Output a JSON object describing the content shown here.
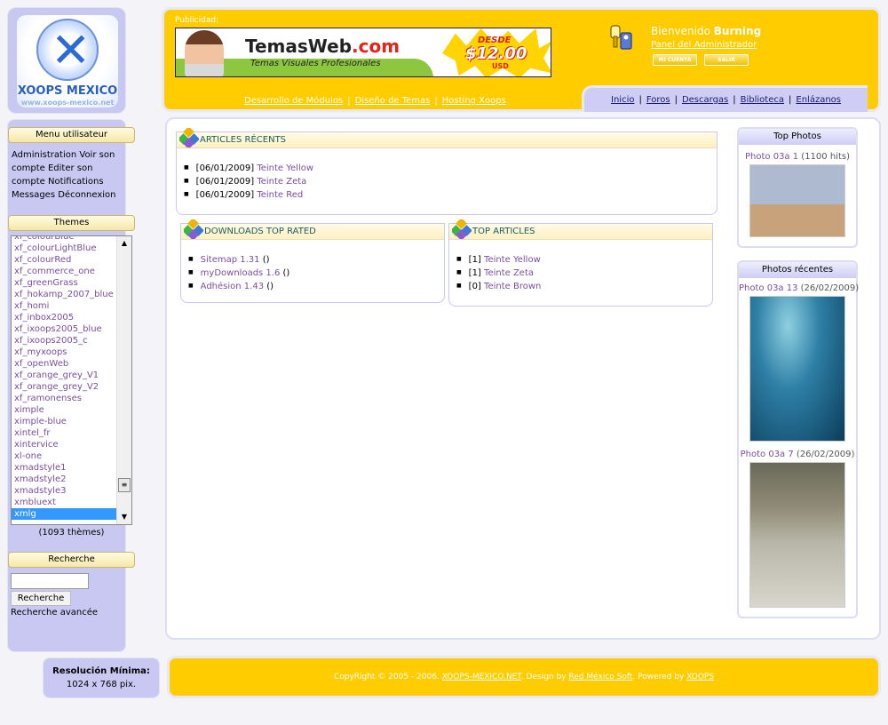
{
  "logo": {
    "title": "XOOPS MEXICO",
    "subtitle": "www.xoops-mexico.net"
  },
  "user_menu": {
    "title": "Menu utilisateur",
    "items": [
      "Administration",
      "Voir son compte",
      "Editer son compte",
      "Notifications",
      "Messages",
      "Déconnexion"
    ]
  },
  "themes": {
    "title": "Themes",
    "items": [
      "xf_colourBlue",
      "xf_colourLightBlue",
      "xf_colourRed",
      "xf_commerce_one",
      "xf_greenGrass",
      "xf_hokamp_2007_blue",
      "xf_homi",
      "xf_inbox2005",
      "xf_ixoops2005_blue",
      "xf_ixoops2005_c",
      "xf_myxoops",
      "xf_openWeb",
      "xf_orange_grey_V1",
      "xf_orange_grey_V2",
      "xf_ramonenses",
      "ximple",
      "ximple-blue",
      "xintel_fr",
      "xintervice",
      "xl-one",
      "xmadstyle1",
      "xmadstyle2",
      "xmadstyle3",
      "xmbluext",
      "xmlg"
    ],
    "selected": "xmlg",
    "count": "(1093 thèmes)"
  },
  "search": {
    "title": "Recherche",
    "button": "Recherche",
    "advanced": "Recherche avancée",
    "value": ""
  },
  "resolution": {
    "label": "Resolución Mínima:",
    "value": "1024 x 768 pix."
  },
  "header": {
    "ad_label": "Publicidad:",
    "banner": {
      "brand": "TemasWeb",
      "brand_suffix": ".com",
      "tagline": "Temas Visuales Profesionales",
      "desde": "DESDE",
      "price": "$12.00",
      "currency": "USD"
    },
    "welcome": "Bienvenido",
    "username": "Burning",
    "admin_link": "Panel del Administrador",
    "btn_account": "MI CUENTA",
    "btn_logout": "SALIR",
    "links": [
      "Desarrollo de Módulos",
      "Diseño de Temas",
      "Hosting Xoops"
    ],
    "nav": [
      "Inicio",
      "Foros",
      "Descargas",
      "Biblioteca",
      "Enlázanos"
    ]
  },
  "articles_recent": {
    "title": "ARTICLES RÉCENTS",
    "items": [
      {
        "date": "[06/01/2009]",
        "title": "Teinte Yellow"
      },
      {
        "date": "[06/01/2009]",
        "title": "Teinte Zeta"
      },
      {
        "date": "[06/01/2009]",
        "title": "Teinte Red"
      }
    ]
  },
  "downloads_top": {
    "title": "DOWNLOADS TOP RATED",
    "items": [
      {
        "name": "Sitemap 1.31",
        "note": "()"
      },
      {
        "name": "myDownloads 1.6",
        "note": "()"
      },
      {
        "name": "Adhésion 1.43",
        "note": "()"
      }
    ]
  },
  "top_articles": {
    "title": "TOP ARTICLES",
    "items": [
      {
        "rank": "[1]",
        "title": "Teinte Yellow"
      },
      {
        "rank": "[1]",
        "title": "Teinte Zeta"
      },
      {
        "rank": "[0]",
        "title": "Teinte Brown"
      }
    ]
  },
  "top_photos": {
    "title": "Top Photos",
    "items": [
      {
        "name": "Photo 03a 1",
        "meta": "(1100 hits)"
      }
    ]
  },
  "recent_photos": {
    "title": "Photos récentes",
    "items": [
      {
        "name": "Photo 03a 13",
        "meta": "(26/02/2009)"
      },
      {
        "name": "Photo 03a 7",
        "meta": "(26/02/2009)"
      }
    ]
  },
  "footer": {
    "prefix": "CopyRight © 2005 - 2006.",
    "site": "XOOPS-MEXICO.NET",
    "design_by": ". Design by",
    "designer": "Red México Soft",
    "powered_by": ". Powered by",
    "powered": "XOOPS"
  }
}
